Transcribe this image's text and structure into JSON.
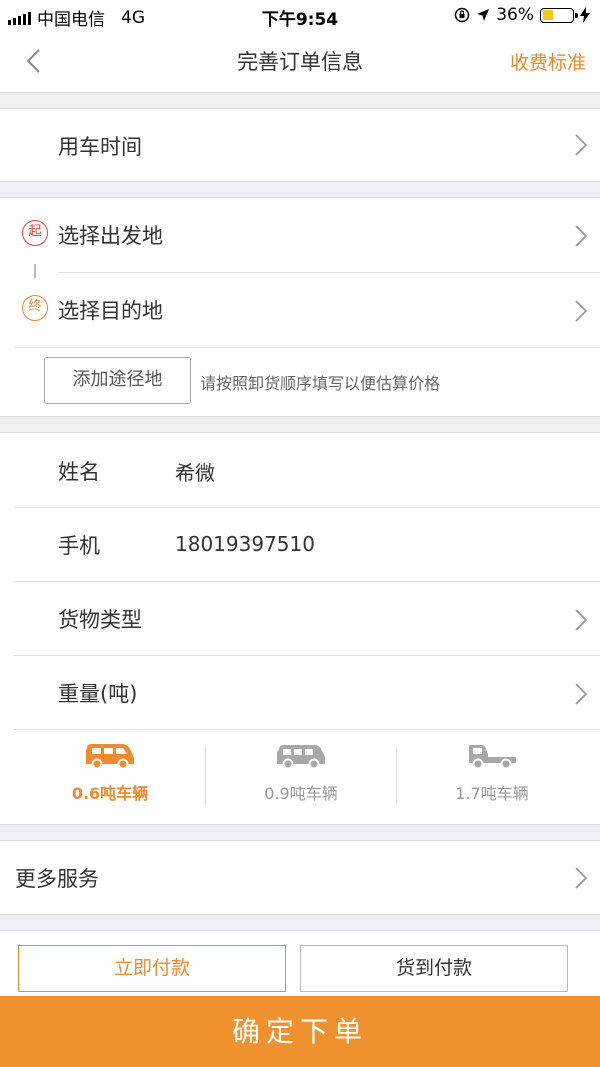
{
  "status_bar": {
    "carrier": "中国电信",
    "network": "4G",
    "time": "下午9:54",
    "battery": "36%"
  },
  "nav": {
    "title": "完善订单信息",
    "right_link": "收费标准"
  },
  "use_time": {
    "label": "用车时间"
  },
  "route": {
    "start_badge": "起",
    "start_label": "选择出发地",
    "end_badge": "终",
    "end_label": "选择目的地",
    "add_stop": "添加途径地",
    "hint": "请按照卸货顺序填写以便估算价格"
  },
  "contact": {
    "name_label": "姓名",
    "name_value": "希微",
    "phone_label": "手机",
    "phone_value": "18019397510",
    "cargo_label": "货物类型",
    "weight_label": "重量(吨)"
  },
  "vehicles": [
    {
      "label": "0.6吨车辆",
      "selected": true,
      "icon": "van-icon"
    },
    {
      "label": "0.9吨车辆",
      "selected": false,
      "icon": "minibus-icon"
    },
    {
      "label": "1.7吨车辆",
      "selected": false,
      "icon": "truck-icon"
    }
  ],
  "more_services": {
    "label": "更多服务"
  },
  "payment": {
    "pay_now": "立即付款",
    "pay_on_delivery": "货到付款"
  },
  "submit": "确定下单",
  "colors": {
    "accent": "#f08a2c",
    "start_red": "#e2453c",
    "inactive_gray": "#a8a8a8"
  }
}
